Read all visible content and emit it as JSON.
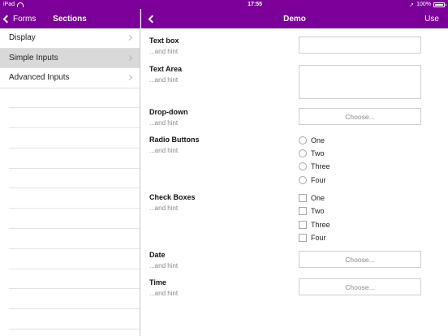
{
  "statusbar": {
    "device": "iPad",
    "time": "17:55",
    "battery": "100%"
  },
  "nav_left": {
    "back_label": "Forms",
    "title": "Sections"
  },
  "nav_right": {
    "title": "Demo",
    "action_label": "Use"
  },
  "sidebar": {
    "items": [
      {
        "label": "Display",
        "active": false
      },
      {
        "label": "Simple Inputs",
        "active": true
      },
      {
        "label": "Advanced Inputs",
        "active": false
      }
    ]
  },
  "form": {
    "textbox": {
      "label": "Text box",
      "hint": "...and hint",
      "value": ""
    },
    "textarea": {
      "label": "Text Area",
      "hint": "...and hint",
      "value": ""
    },
    "dropdown": {
      "label": "Drop-down",
      "hint": "...and hint",
      "button": "Choose..."
    },
    "radio": {
      "label": "Radio Buttons",
      "hint": "...and hint",
      "options": [
        "One",
        "Two",
        "Three",
        "Four"
      ]
    },
    "checkbox": {
      "label": "Check Boxes",
      "hint": "...and hint",
      "options": [
        "One",
        "Two",
        "Three",
        "Four"
      ]
    },
    "date": {
      "label": "Date",
      "hint": "...and hint",
      "button": "Choose..."
    },
    "time": {
      "label": "Time",
      "hint": "...and hint",
      "button": "Choose..."
    }
  },
  "colors": {
    "accent": "#7b0099",
    "selected_row": "#d9d9d9"
  }
}
